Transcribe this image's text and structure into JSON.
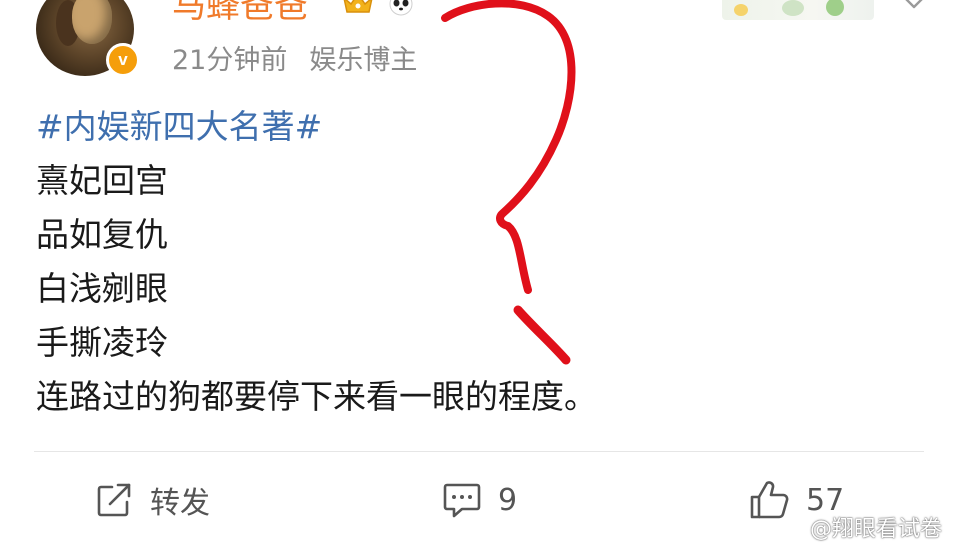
{
  "post": {
    "author": {
      "name": "马蜂爸爸",
      "badge_icon": "verified-v-icon",
      "badge_text": "v"
    },
    "meta": {
      "time": "21分钟前",
      "source": "娱乐博主"
    },
    "body": {
      "topic": "#内娱新四大名著#",
      "lines": [
        "熹妃回宫",
        "品如复仇",
        "白浅剜眼",
        "手撕凌玲",
        "连路过的狗都要停下来看一眼的程度。"
      ]
    }
  },
  "actions": {
    "forward": {
      "label": "转发",
      "icon": "share-icon"
    },
    "comment": {
      "count": "9",
      "icon": "comment-icon"
    },
    "like": {
      "count": "57",
      "icon": "thumbs-up-icon"
    }
  },
  "watermark": {
    "text": "@翔眼看试卷",
    "icon": "weibo-icon"
  },
  "colors": {
    "username": "#f07a2a",
    "topic": "#3f6fae",
    "meta": "#8a8a8a",
    "body_text": "#1a1a1a",
    "annotation": "#e0101a",
    "verified": "#f59e0b"
  }
}
